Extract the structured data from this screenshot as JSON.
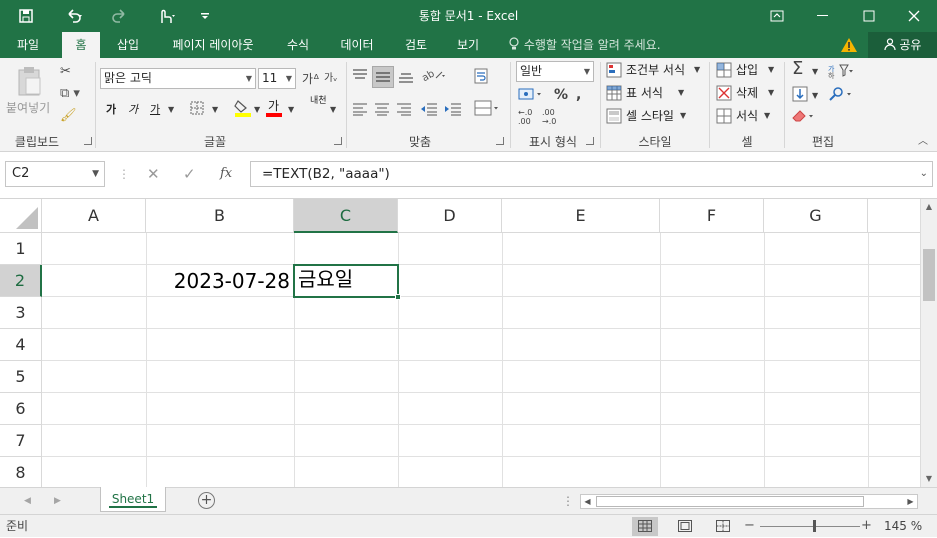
{
  "window": {
    "title": "통합 문서1 - Excel"
  },
  "tabs": [
    {
      "label": "파일"
    },
    {
      "label": "홈"
    },
    {
      "label": "삽입"
    },
    {
      "label": "페이지 레이아웃"
    },
    {
      "label": "수식"
    },
    {
      "label": "데이터"
    },
    {
      "label": "검토"
    },
    {
      "label": "보기"
    }
  ],
  "tell_me": "수행할 작업을 알려 주세요.",
  "share_label": "공유",
  "ribbon": {
    "clipboard": {
      "paste_label": "붙여넣기",
      "group_label": "클립보드"
    },
    "font": {
      "font_name": "맑은 고딕",
      "font_size": "11",
      "group_label": "글꼴",
      "bold": "가",
      "italic": "가",
      "underline": "가",
      "font_color_glyph": "가",
      "phonetic_glyph": "내천"
    },
    "alignment": {
      "group_label": "맞춤"
    },
    "number": {
      "format": "일반",
      "group_label": "표시 형식"
    },
    "styles": {
      "conditional": "조건부 서식",
      "table": "표 서식",
      "cell_styles": "셀 스타일",
      "group_label": "스타일"
    },
    "cells": {
      "insert": "삽입",
      "delete": "삭제",
      "format": "서식",
      "group_label": "셀"
    },
    "editing": {
      "group_label": "편집"
    }
  },
  "formula_bar": {
    "name_box": "C2",
    "formula": "=TEXT(B2, \"aaaa\")"
  },
  "grid": {
    "columns": [
      "A",
      "B",
      "C",
      "D",
      "E",
      "F",
      "G"
    ],
    "selected_column": "C",
    "rows": [
      "1",
      "2",
      "3",
      "4",
      "5",
      "6",
      "7",
      "8"
    ],
    "selected_row": "2",
    "cells": {
      "B2": "2023-07-28",
      "C2": "금요일"
    }
  },
  "sheets": {
    "active": "Sheet1"
  },
  "status": {
    "ready": "준비",
    "zoom": "145 %"
  },
  "colors": {
    "accent": "#217346",
    "selected_header": "#d2d2d2"
  }
}
